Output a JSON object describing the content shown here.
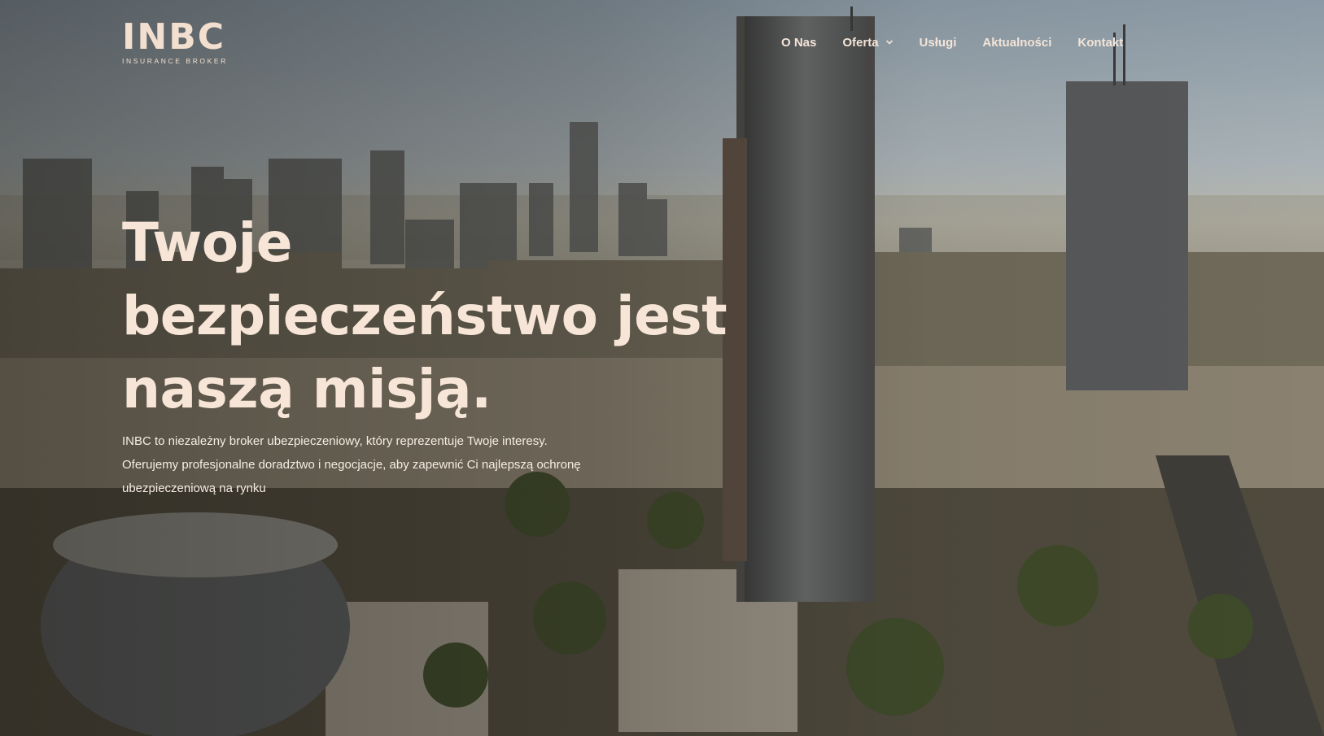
{
  "header": {
    "logo_text": "INBC",
    "logo_tagline": "INSURANCE BROKER",
    "nav": [
      {
        "label": "O Nas",
        "has_dropdown": false
      },
      {
        "label": "Oferta",
        "has_dropdown": true
      },
      {
        "label": "Usługi",
        "has_dropdown": false
      },
      {
        "label": "Aktualności",
        "has_dropdown": false
      },
      {
        "label": "Kontakt",
        "has_dropdown": false
      }
    ]
  },
  "hero": {
    "headline_lines": [
      "Twoje",
      "bezpieczeństwo jest",
      "naszą misją."
    ],
    "lead_lines": [
      "INBC to niezależny broker ubezpieczeniowy, który reprezentuje Twoje interesy.",
      "Oferujemy profesjonalne doradztwo i negocjacje, aby zapewnić Ci najlepszą ochronę",
      "ubezpieczeniową na rynku"
    ]
  },
  "colors": {
    "text_primary": "#f7e6d8",
    "logo": "#f3dfcf"
  },
  "icons": {
    "dropdown": "chevron-down-icon"
  }
}
